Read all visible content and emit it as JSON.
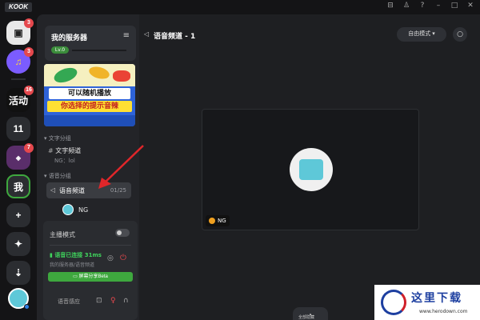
{
  "app": {
    "logo": "KOOK"
  },
  "window_controls": [
    "inbox-icon",
    "shirt-icon",
    "help-icon",
    "minimize-icon",
    "maximize-icon",
    "close-icon"
  ],
  "rail": {
    "items": [
      {
        "name": "messages",
        "badge": "3",
        "color": "#e8e8e8"
      },
      {
        "name": "notifications",
        "badge": "3",
        "color": "#7b5cff"
      },
      {
        "name": "activity",
        "label": "活动",
        "badge": "16"
      },
      {
        "name": "server-11",
        "label": "11"
      },
      {
        "name": "server-game",
        "badge": "7"
      },
      {
        "name": "server-me",
        "label": "我"
      },
      {
        "name": "add-server",
        "label": "+"
      },
      {
        "name": "discover",
        "label": "✦"
      },
      {
        "name": "download",
        "label": "⇣"
      }
    ]
  },
  "server": {
    "name": "我的服务器",
    "level": "Lv.0",
    "banner": {
      "line1": "可以随机播放",
      "line2": "你选择的提示音辣"
    }
  },
  "channels": {
    "text_category": "文字分组",
    "text_channel": "文字频道",
    "text_channel_sub": "NG：lol",
    "voice_category": "语音分组",
    "voice_channel": "语音频道",
    "voice_count": "01/25",
    "member_name": "NG"
  },
  "status": {
    "host_mode": "主播模式",
    "connected": "语音已连接 31ms",
    "path": "我的服务器/语音频道",
    "share_button": "屏幕分享Beta",
    "sense": "语音感应"
  },
  "main": {
    "title": "语音频道 - 1",
    "mode": "自由模式",
    "tile_name": "NG",
    "fullscreen": "全部隐藏"
  },
  "watermark": {
    "text": "这里下载",
    "url": "www.herodown.com"
  },
  "colors": {
    "accent": "#3ea83e",
    "danger": "#e5484d",
    "annotation": "#e0262a"
  }
}
